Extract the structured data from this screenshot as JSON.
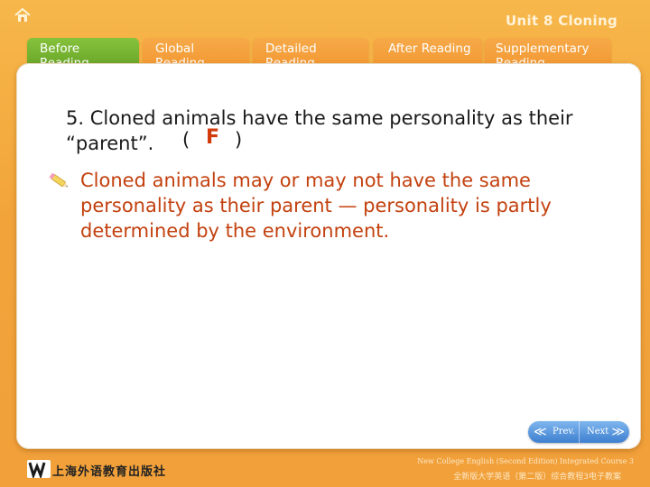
{
  "header": {
    "home_icon": "home-icon",
    "unit_title": "Unit 8 Cloning"
  },
  "tabs": [
    {
      "label": "Before Reading",
      "active": true
    },
    {
      "label": "Global Reading",
      "active": false
    },
    {
      "label": "Detailed Reading",
      "active": false
    },
    {
      "label": "After Reading",
      "active": false
    },
    {
      "label": "Supplementary Reading",
      "active": false
    }
  ],
  "content": {
    "question": "5. Cloned animals have the same personality as their “parent”.",
    "paren_open": "(",
    "paren_close": ")",
    "answer": "F",
    "explanation": "Cloned animals may or may not have the same personality as their parent — personality is partly determined by the environment.",
    "bullet_icon": "pencil-icon"
  },
  "navigation": {
    "prev_label": "Prev.",
    "next_label": "Next",
    "prev_arrow": "≪",
    "next_arrow": "≫"
  },
  "footer": {
    "publisher": "上海外语教育出版社",
    "course_en": "New College English (Second Edition) Integrated Course 3",
    "course_cn": "全新版大学英语（第二版）综合教程3电子教案"
  },
  "colors": {
    "background": "#f2a43a",
    "active_tab": "#79b534",
    "answer": "#d23a0a",
    "explanation": "#c3410f",
    "nav_button": "#4a8ad6"
  }
}
